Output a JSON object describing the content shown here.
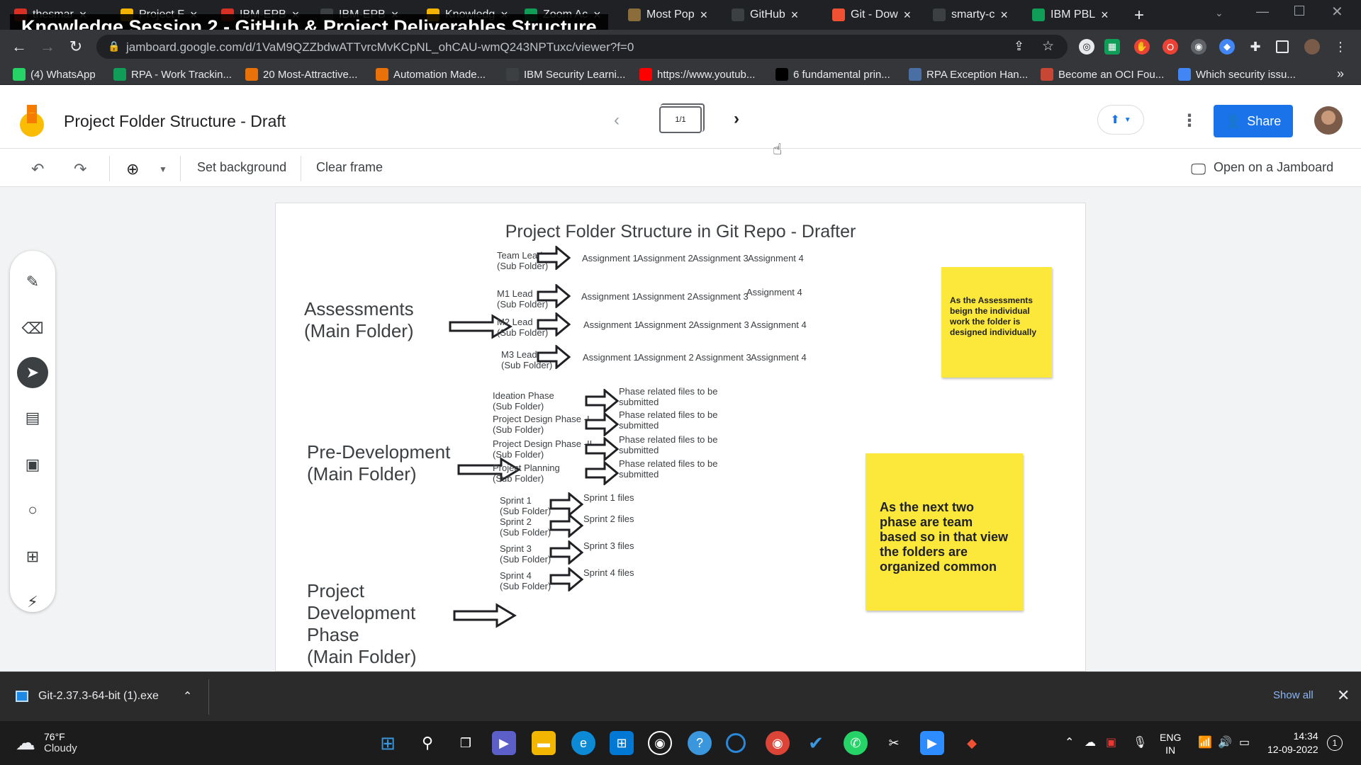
{
  "video_title": "Knowledge Session 2 - GitHub & Project Deliverables Structure",
  "browser": {
    "tabs": [
      {
        "title": "thesmar",
        "icon": "gmail-icon",
        "color": "#d93025"
      },
      {
        "title": "Project F",
        "icon": "jamboard-icon",
        "color": "#f4b400"
      },
      {
        "title": "IBM-EPB",
        "icon": "gmail-icon",
        "color": "#d93025"
      },
      {
        "title": "IBM-EPB",
        "icon": "github-icon",
        "color": "#3c4043"
      },
      {
        "title": "Knowledg",
        "icon": "jamboard-icon",
        "color": "#f4b400"
      },
      {
        "title": "Zoom Ac",
        "icon": "sheets-icon",
        "color": "#0f9d58"
      },
      {
        "title": "Most Pop",
        "icon": "image-icon",
        "color": "#8a6d3b"
      },
      {
        "title": "GitHub",
        "icon": "github-icon",
        "color": "#3c4043"
      },
      {
        "title": "Git - Dow",
        "icon": "git-icon",
        "color": "#f05133"
      },
      {
        "title": "smarty-c",
        "icon": "github-icon",
        "color": "#3c4043"
      },
      {
        "title": "IBM PBL",
        "icon": "sheets-icon",
        "color": "#0f9d58"
      }
    ],
    "url": "jamboard.google.com/d/1VaM9QZZbdwATTvrcMvKCpNL_ohCAU-wmQ243NPTuxc/viewer?f=0",
    "bookmarks": [
      {
        "label": "(4) WhatsApp",
        "color": "#25d366"
      },
      {
        "label": "RPA - Work Trackin...",
        "color": "#0f9d58"
      },
      {
        "label": "20 Most-Attractive...",
        "color": "#e8710a"
      },
      {
        "label": "Automation Made...",
        "color": "#e8710a"
      },
      {
        "label": "IBM Security Learni...",
        "color": "#3c4043"
      },
      {
        "label": "https://www.youtub...",
        "color": "#ff0000"
      },
      {
        "label": "6 fundamental prin...",
        "color": "#000000"
      },
      {
        "label": "RPA Exception Han...",
        "color": "#4a6fa5"
      },
      {
        "label": "Become an OCI Fou...",
        "color": "#c74634"
      },
      {
        "label": "Which security issu...",
        "color": "#4285f4"
      }
    ]
  },
  "jamboard": {
    "doc_title": "Project Folder Structure - Draft",
    "frame_indicator": "1/1",
    "share_label": "Share",
    "toolbar": {
      "set_background": "Set background",
      "clear_frame": "Clear frame",
      "open_on_jamboard": "Open on a Jamboard"
    }
  },
  "canvas": {
    "title": "Project Folder Structure in Git Repo - Drafter",
    "assessments": {
      "label": "Assessments\n(Main Folder)",
      "rows": [
        {
          "sub": "Team Lead\n(Sub Folder)",
          "assignments": [
            "Assignment 1",
            "Assignment 2",
            "Assignment 3",
            "Assignment 4"
          ]
        },
        {
          "sub": "M1 Lead\n(Sub Folder)",
          "assignments": [
            "Assignment 1",
            "Assignment 2",
            "Assignment 3",
            "Assignment 4"
          ]
        },
        {
          "sub": "M2 Lead\n(Sub Folder)",
          "assignments": [
            "Assignment 1",
            "Assignment 2",
            "Assignment 3",
            "Assignment 4"
          ]
        },
        {
          "sub": "M3 Lead\n(Sub Folder)",
          "assignments": [
            "Assignment 1",
            "Assignment 2",
            "Assignment 3",
            "Assignment 4"
          ]
        }
      ],
      "note": "As the Assessments beign the individual work the folder is designed individually"
    },
    "predev": {
      "label": "Pre-Development\n(Main Folder)",
      "rows": [
        {
          "sub": "Ideation Phase\n(Sub Folder)",
          "files": "Phase related files to be\nsubmitted"
        },
        {
          "sub": "Project Design Phase -I\n(Sub Folder)",
          "files": "Phase related files to be\nsubmitted"
        },
        {
          "sub": "Project Design Phase -II\n(Sub Folder)",
          "files": "Phase related files to be\nsubmitted"
        },
        {
          "sub": "Project Planning\n(Sub Folder)",
          "files": "Phase related files to be\nsubmitted"
        }
      ],
      "note": "As the next two phase are team based so in that view the folders are organized common"
    },
    "devphase": {
      "label": "Project\nDevelopment\nPhase\n(Main Folder)",
      "rows": [
        {
          "sub": "Sprint 1\n(Sub Folder)",
          "files": "Sprint 1 files"
        },
        {
          "sub": "Sprint 2\n(Sub Folder)",
          "files": "Sprint 2 files"
        },
        {
          "sub": "Sprint 3\n(Sub Folder)",
          "files": "Sprint 3 files"
        },
        {
          "sub": "Sprint 4\n(Sub Folder)",
          "files": "Sprint 4 files"
        }
      ]
    }
  },
  "download": {
    "filename": "Git-2.37.3-64-bit (1).exe",
    "show_all": "Show all"
  },
  "taskbar": {
    "weather_temp": "76°F",
    "weather_desc": "Cloudy",
    "lang_1": "ENG",
    "lang_2": "IN",
    "time": "14:34",
    "date": "12-09-2022",
    "notifications": "1"
  }
}
